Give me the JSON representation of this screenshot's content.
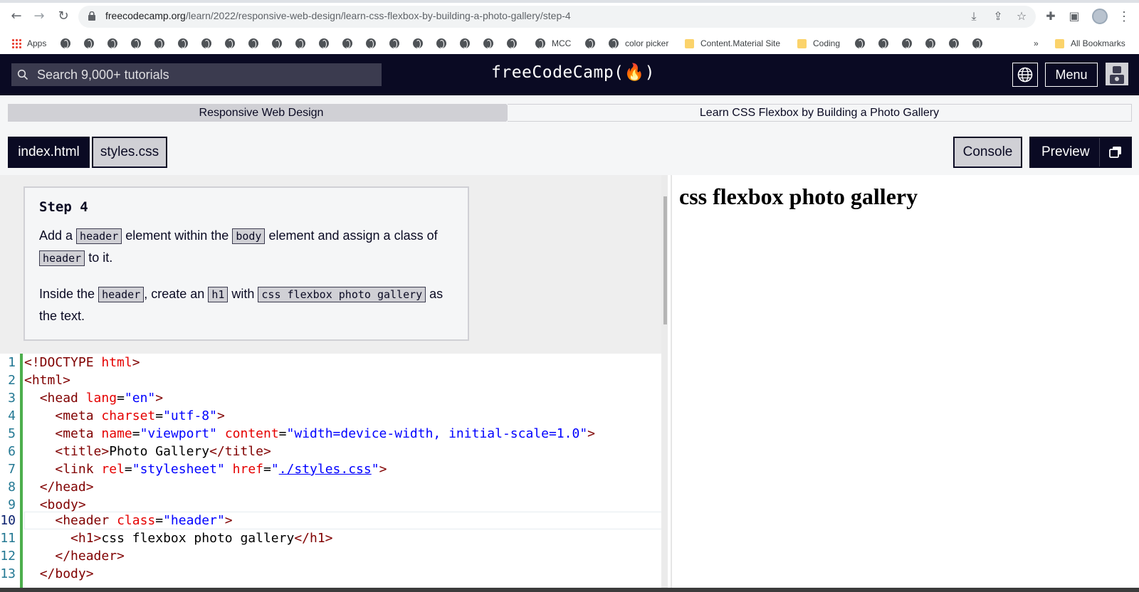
{
  "browser": {
    "url_domain": "freecodecamp.org",
    "url_path": "/learn/2022/responsive-web-design/learn-css-flexbox-by-building-a-photo-gallery/step-4",
    "bookmarks": {
      "apps": "Apps",
      "mcc": "MCC",
      "color_picker": "color picker",
      "content_material": "Content.Material Site",
      "coding": "Coding",
      "overflow": "»",
      "all_bookmarks": "All Bookmarks"
    }
  },
  "fcc_nav": {
    "search_placeholder": "Search 9,000+ tutorials",
    "brand": "freeCodeCamp(🔥)",
    "menu_label": "Menu"
  },
  "breadcrumb": {
    "superblock": "Responsive Web Design",
    "block": "Learn CSS Flexbox by Building a Photo Gallery"
  },
  "tabs": {
    "index": "index.html",
    "styles": "styles.css",
    "console": "Console",
    "preview": "Preview"
  },
  "instructions": {
    "title": "Step 4",
    "p1_a": "Add a ",
    "p1_code1": "header",
    "p1_b": " element within the ",
    "p1_code2": "body",
    "p1_c": " element and assign a class of ",
    "p1_code3": "header",
    "p1_d": " to it.",
    "p2_a": "Inside the ",
    "p2_code1": "header",
    "p2_b": ", create an ",
    "p2_code2": "h1",
    "p2_c": " with ",
    "p2_code3": "css flexbox photo gallery",
    "p2_d": " as the text."
  },
  "editor": {
    "lines": [
      {
        "n": "1"
      },
      {
        "n": "2"
      },
      {
        "n": "3"
      },
      {
        "n": "4"
      },
      {
        "n": "5"
      },
      {
        "n": "6"
      },
      {
        "n": "7"
      },
      {
        "n": "8"
      },
      {
        "n": "9"
      },
      {
        "n": "10"
      },
      {
        "n": "11"
      },
      {
        "n": "12"
      },
      {
        "n": "13"
      }
    ]
  },
  "preview": {
    "h1": "css flexbox photo gallery"
  }
}
